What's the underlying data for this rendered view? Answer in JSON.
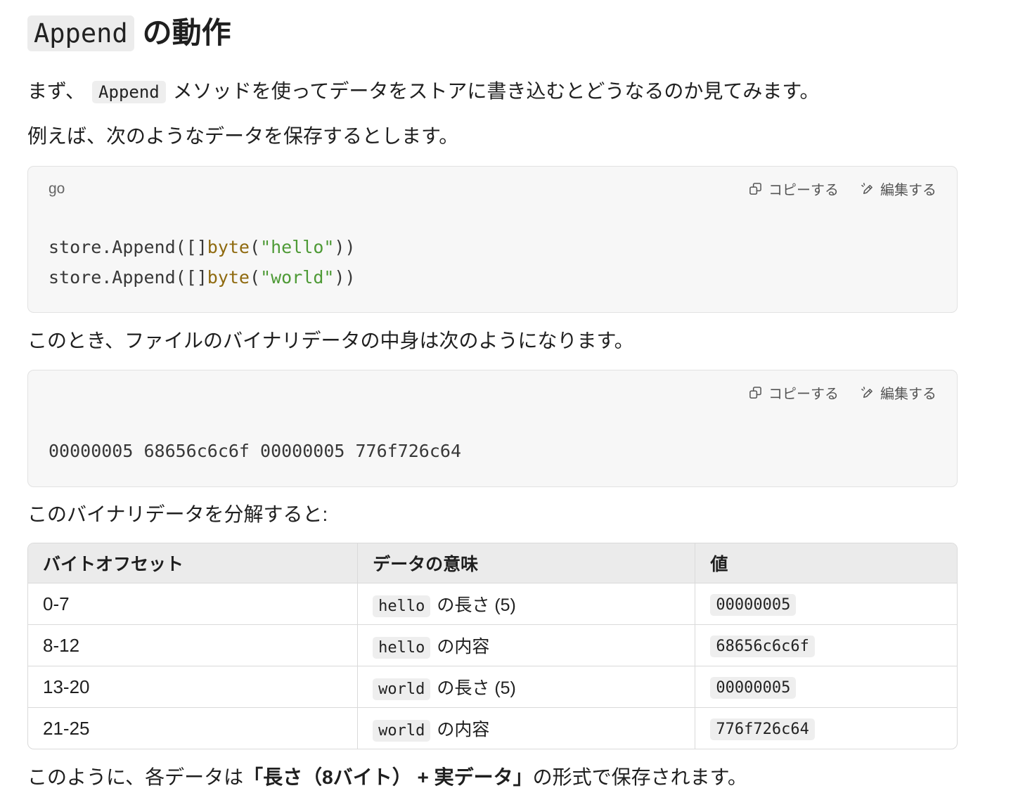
{
  "heading": {
    "code": "Append",
    "text": "の動作"
  },
  "intro": {
    "before": "まず、",
    "code": "Append",
    "after": "メソッドを使ってデータをストアに書き込むとどうなるのか見てみます。"
  },
  "example_text": "例えば、次のようなデータを保存するとします。",
  "code_blocks": [
    {
      "language": "go",
      "copy_label": "コピーする",
      "edit_label": "編集する",
      "copy_icon": "copy-icon",
      "edit_icon": "edit-icon",
      "lines": [
        [
          "store.Append([]",
          "byte",
          "(",
          "\"hello\"",
          "))"
        ],
        [
          "store.Append([]",
          "byte",
          "(",
          "\"world\"",
          "))"
        ]
      ]
    },
    {
      "copy_label": "コピーする",
      "edit_label": "編集する",
      "copy_icon": "copy-icon",
      "edit_icon": "edit-icon",
      "lines": [
        [
          "00000005 68656c6c6f 00000005 776f726c64"
        ]
      ]
    }
  ],
  "binary_text": "このとき、ファイルのバイナリデータの中身は次のようになります。",
  "breakdown_text": "このバイナリデータを分解すると:",
  "table": {
    "headers": [
      "バイトオフセット",
      "データの意味",
      "値"
    ],
    "rows": [
      {
        "offset": "0-7",
        "meaning_code": "hello",
        "meaning_text": "の長さ (5)",
        "value": "00000005"
      },
      {
        "offset": "8-12",
        "meaning_code": "hello",
        "meaning_text": "の内容",
        "value": "68656c6c6f"
      },
      {
        "offset": "13-20",
        "meaning_code": "world",
        "meaning_text": "の長さ (5)",
        "value": "00000005"
      },
      {
        "offset": "21-25",
        "meaning_code": "world",
        "meaning_text": "の内容",
        "value": "776f726c64"
      }
    ]
  },
  "conclusion": {
    "before": "このように、各データは",
    "bold": "「長さ（8バイト） + 実データ」",
    "after": "の形式で保存されます。"
  },
  "colors": {
    "text": "#1f1f1f",
    "code_plain": "#383838",
    "code_type": "#8f6a0f",
    "code_string": "#4e9a36",
    "code_block_bg": "#f7f7f7",
    "code_border": "#e2e2e2",
    "inline_code_bg": "#eeeeee",
    "heading_code_bg": "#ececec",
    "table_header_bg": "#ebebeb",
    "table_border": "#dadada"
  }
}
